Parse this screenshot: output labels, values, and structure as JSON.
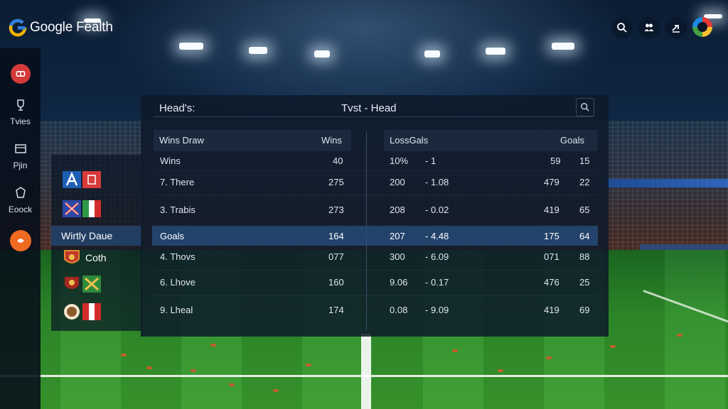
{
  "app": {
    "title": "Google Fealth"
  },
  "top_icons": [
    "search-icon",
    "people-icon",
    "share-icon",
    "avatar"
  ],
  "sidebar": {
    "items": [
      {
        "label": "",
        "icon": "red-logo-icon"
      },
      {
        "label": "Tvies",
        "icon": "trophy-icon"
      },
      {
        "label": "Pjin",
        "icon": "flag-icon"
      },
      {
        "label": "Eoock",
        "icon": "badge-icon"
      },
      {
        "label": "",
        "icon": "orange-logo-icon"
      }
    ]
  },
  "teams": {
    "highlight_label": "Wirtly Daue",
    "rows": [
      {
        "name": "",
        "flag_colors": [
          "#1e5fb5",
          "#d73b3b"
        ]
      },
      {
        "name": "",
        "flag_colors": [
          "#2a4aa8",
          "#2e9a48"
        ]
      },
      {
        "name": "Coth",
        "flag_colors": [
          "#c0392b",
          "#e08a2a"
        ]
      },
      {
        "name": "",
        "flag_colors": [
          "#a5281f",
          "#2f8a3b"
        ]
      },
      {
        "name": "",
        "flag_colors": [
          "#8a5a2a",
          "#d22b2b"
        ]
      }
    ]
  },
  "panel": {
    "header": "Head's:",
    "title": "Tvst - Head",
    "left_columns": {
      "a": "Wins Draw",
      "b": "Wins"
    },
    "right_columns": {
      "a": "LossGals",
      "b": "Goals"
    },
    "rows": [
      {
        "name": "Wins",
        "v1": "40",
        "v2": "10%",
        "v3": "- 1",
        "v4": "59",
        "v5": "15"
      },
      {
        "name": "7. There",
        "v1": "275",
        "v2": "200",
        "v3": "- 1.08",
        "v4": "479",
        "v5": "22"
      },
      {
        "name": "3. Trabis",
        "v1": "273",
        "v2": "208",
        "v3": "- 0.02",
        "v4": "419",
        "v5": "65"
      },
      {
        "name": "Goals",
        "v1": "164",
        "v2": "207",
        "v3": "- 4.48",
        "v4": "175",
        "v5": "64"
      },
      {
        "name": "4. Thovs",
        "v1": "077",
        "v2": "300",
        "v3": "- 6.09",
        "v4": "071",
        "v5": "88"
      },
      {
        "name": "6. Lhove",
        "v1": "160",
        "v2": "9.06",
        "v3": "- 0.17",
        "v4": "476",
        "v5": "25"
      },
      {
        "name": "9. Lheal",
        "v1": "174",
        "v2": "0.08",
        "v3": "- 9.09",
        "v4": "419",
        "v5": "69"
      }
    ]
  },
  "colors": {
    "accent_highlight": "#2f5a8a",
    "sidebar_red": "#d43a3a",
    "sidebar_orange": "#f06a22"
  }
}
